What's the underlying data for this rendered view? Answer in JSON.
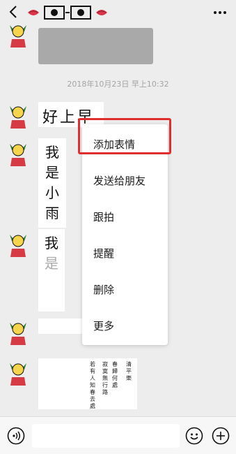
{
  "header": {
    "back_icon": "chevron-left-icon",
    "title_icon": "lips-eyes-sticker-icon",
    "more_icon": "more-dots-icon"
  },
  "chat": {
    "timestamp": "2018年10月23日 早上10:32",
    "messages": [
      {
        "type": "image",
        "text": ""
      },
      {
        "type": "sticker",
        "text": "好上早"
      },
      {
        "type": "sticker",
        "lines": [
          "我",
          "是",
          "小",
          "雨"
        ]
      },
      {
        "type": "sticker",
        "lines": [
          "我",
          "是"
        ]
      },
      {
        "type": "sticker",
        "text": ""
      },
      {
        "type": "sticker",
        "poem_cols": [
          "清平樂",
          "春歸何處",
          "寂寞無行路",
          "若有人知春去處"
        ]
      }
    ]
  },
  "context_menu": {
    "items": [
      {
        "label": "添加表情",
        "highlighted": true
      },
      {
        "label": "发送给朋友"
      },
      {
        "label": "跟拍"
      },
      {
        "label": "提醒"
      },
      {
        "label": "删除"
      },
      {
        "label": "更多"
      }
    ],
    "highlight_color": "#e02d2d"
  },
  "input_bar": {
    "voice_icon": "voice-icon",
    "emoji_icon": "emoji-icon",
    "plus_icon": "plus-icon"
  }
}
